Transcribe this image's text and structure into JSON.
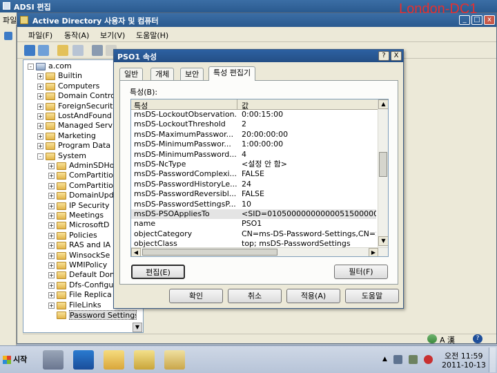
{
  "outer": {
    "title": "ADSI 편집",
    "tab": "파일"
  },
  "badge": "London-DC1",
  "aduc": {
    "title": "Active Directory 사용자 및 컴퓨터",
    "menu": [
      "파일(F)",
      "동작(A)",
      "보기(V)",
      "도움말(H)"
    ],
    "tree": [
      {
        "label": "a.com",
        "depth": 0,
        "exp": "-"
      },
      {
        "label": "Builtin",
        "depth": 1,
        "exp": "+"
      },
      {
        "label": "Computers",
        "depth": 1,
        "exp": "+"
      },
      {
        "label": "Domain Contro",
        "depth": 1,
        "exp": "+"
      },
      {
        "label": "ForeignSecurit",
        "depth": 1,
        "exp": "+"
      },
      {
        "label": "LostAndFound",
        "depth": 1,
        "exp": "+"
      },
      {
        "label": "Managed Serv",
        "depth": 1,
        "exp": "+"
      },
      {
        "label": "Marketing",
        "depth": 1,
        "exp": "+"
      },
      {
        "label": "Program Data",
        "depth": 1,
        "exp": "+"
      },
      {
        "label": "System",
        "depth": 1,
        "exp": "-"
      },
      {
        "label": "AdminSDHo",
        "depth": 2,
        "exp": "+"
      },
      {
        "label": "ComPartitio",
        "depth": 2,
        "exp": "+"
      },
      {
        "label": "ComPartitio",
        "depth": 2,
        "exp": "+"
      },
      {
        "label": "DomainUpd",
        "depth": 2,
        "exp": "+"
      },
      {
        "label": "IP Security",
        "depth": 2,
        "exp": "+"
      },
      {
        "label": "Meetings",
        "depth": 2,
        "exp": "+"
      },
      {
        "label": "MicrosoftD",
        "depth": 2,
        "exp": "+"
      },
      {
        "label": "Policies",
        "depth": 2,
        "exp": "+"
      },
      {
        "label": "RAS and IA",
        "depth": 2,
        "exp": "+"
      },
      {
        "label": "WinsockSe",
        "depth": 2,
        "exp": "+"
      },
      {
        "label": "WMIPolicy",
        "depth": 2,
        "exp": "+"
      },
      {
        "label": "Default Don",
        "depth": 2,
        "exp": "+"
      },
      {
        "label": "Dfs-Configu",
        "depth": 2,
        "exp": "+"
      },
      {
        "label": "File Replica",
        "depth": 2,
        "exp": "+"
      },
      {
        "label": "FileLinks",
        "depth": 2,
        "exp": "+"
      },
      {
        "label": "Password Settings",
        "depth": 2,
        "exp": ""
      }
    ]
  },
  "dialog": {
    "title": "PSO1 속성",
    "help": "?",
    "close": "X",
    "tabs": [
      "일반",
      "개체",
      "보안",
      "특성 편집기"
    ],
    "attrs_label": "특성(B):",
    "columns": [
      "특성",
      "값"
    ],
    "rows": [
      [
        "msDS-LockoutObservation...",
        "0:00:15:00"
      ],
      [
        "msDS-LockoutThreshold",
        "2"
      ],
      [
        "msDS-MaximumPasswor...",
        "20:00:00:00"
      ],
      [
        "msDS-MinimumPasswor...",
        "1:00:00:00"
      ],
      [
        "msDS-MinimumPassword...",
        "4"
      ],
      [
        "msDS-NcType",
        "<설정 안 함>"
      ],
      [
        "msDS-PasswordComplexi...",
        "FALSE"
      ],
      [
        "msDS-PasswordHistoryLe...",
        "24"
      ],
      [
        "msDS-PasswordReversibl...",
        "FALSE"
      ],
      [
        "msDS-PasswordSettingsP...",
        "10"
      ],
      [
        "msDS-PSOAppliesTo",
        "<SID=0105000000000005150000000dd4e1b"
      ],
      [
        "name",
        "PSO1"
      ],
      [
        "objectCategory",
        "CN=ms-DS-Password-Settings,CN=Sc"
      ],
      [
        "objectClass",
        "top; msDS-PasswordSettings"
      ]
    ],
    "selected_row": 10,
    "btn_edit": "편집(E)",
    "btn_filter": "필터(F)",
    "btn_ok": "확인",
    "btn_cancel": "취소",
    "btn_apply": "적용(A)",
    "btn_help": "도움말"
  },
  "status": {
    "ime": "A 漢"
  },
  "taskbar": {
    "start": "시작",
    "time": "오전 11:59",
    "date": "2011-10-13"
  }
}
